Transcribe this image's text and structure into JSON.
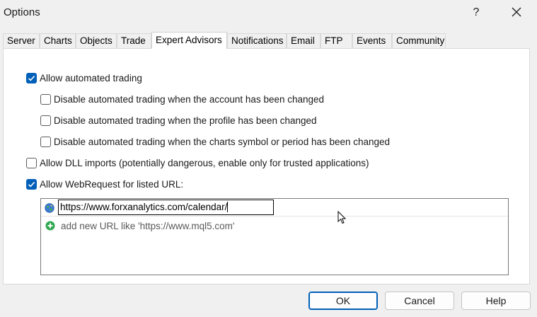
{
  "window": {
    "title": "Options",
    "help_label": "?"
  },
  "tabs": [
    {
      "label": "Server"
    },
    {
      "label": "Charts"
    },
    {
      "label": "Objects"
    },
    {
      "label": "Trade"
    },
    {
      "label": "Expert Advisors",
      "active": true
    },
    {
      "label": "Notifications"
    },
    {
      "label": "Email"
    },
    {
      "label": "FTP"
    },
    {
      "label": "Events"
    },
    {
      "label": "Community"
    }
  ],
  "options": {
    "allow_auto_trading": {
      "label": "Allow automated trading",
      "checked": true
    },
    "disable_on_account_change": {
      "label": "Disable automated trading when the account has been changed",
      "checked": false
    },
    "disable_on_profile_change": {
      "label": "Disable automated trading when the profile has been changed",
      "checked": false
    },
    "disable_on_symbol_change": {
      "label": "Disable automated trading when the charts symbol or period has been changed",
      "checked": false
    },
    "allow_dll": {
      "label": "Allow DLL imports (potentially dangerous, enable only for trusted applications)",
      "checked": false
    },
    "allow_webrequest": {
      "label": "Allow WebRequest for listed URL:",
      "checked": true
    }
  },
  "url_list": {
    "current_value": "https://www.forxanalytics.com/calendar/",
    "add_hint": "add new URL like 'https://www.mql5.com'",
    "entry_icon": "globe-icon",
    "add_icon": "plus-circle-icon"
  },
  "buttons": {
    "ok": "OK",
    "cancel": "Cancel",
    "help": "Help"
  },
  "colors": {
    "accent": "#005fb8",
    "add_icon_green": "#2fa84f",
    "dialog_bg": "#f0f0f0"
  }
}
